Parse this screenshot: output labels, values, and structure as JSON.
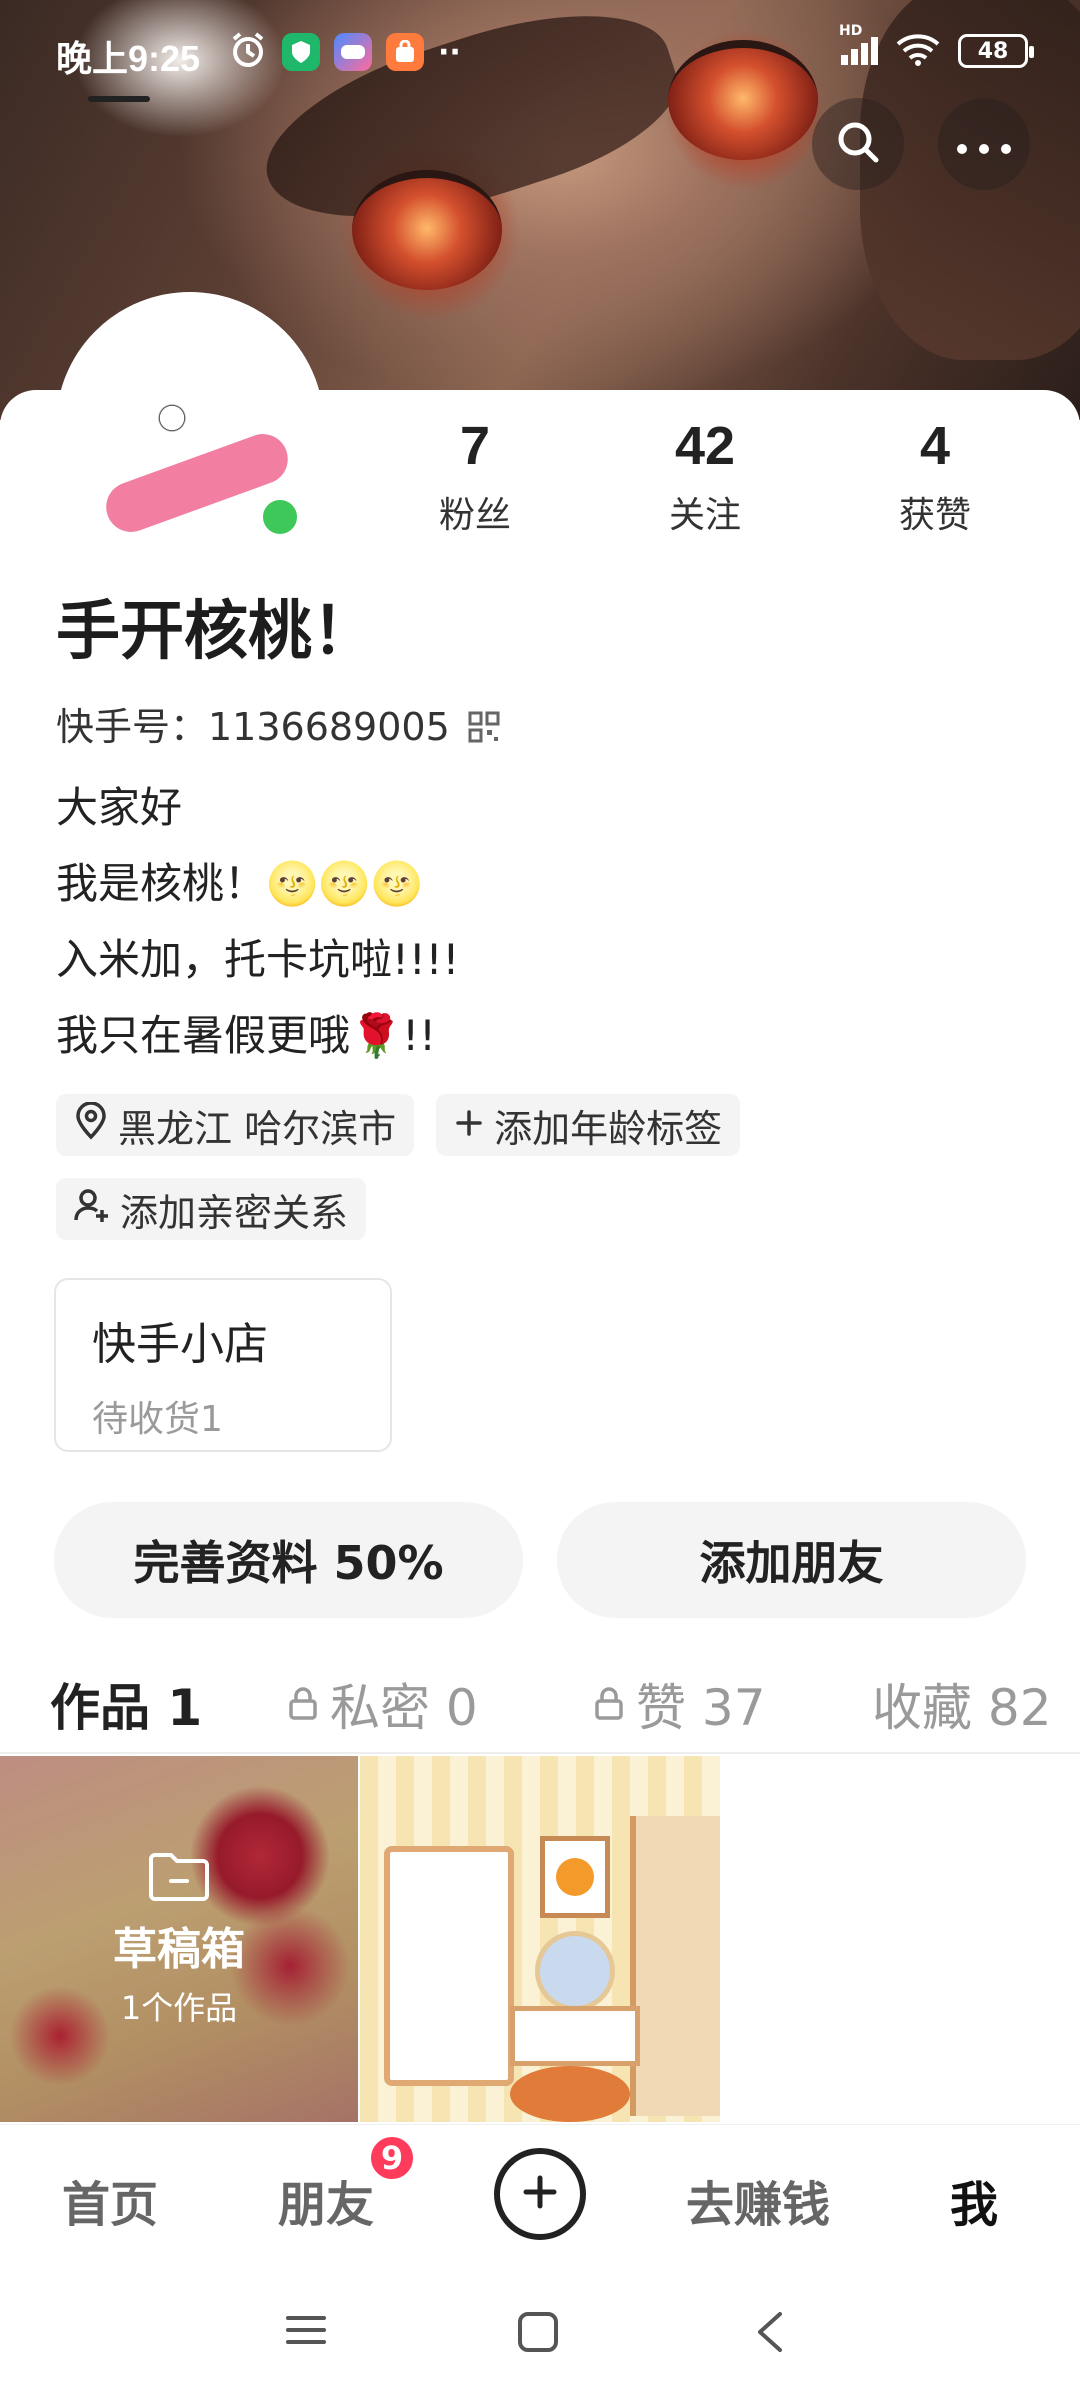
{
  "status_bar": {
    "time": "晚上9:25",
    "network_label": "HD",
    "battery": "48",
    "icons": [
      "alarm-icon",
      "shield-app-icon",
      "game-app-icon",
      "shop-app-icon",
      "more-dots-icon",
      "signal-icon",
      "wifi-icon",
      "battery-icon"
    ]
  },
  "header": {
    "search_icon": "search-icon",
    "more_icon": "more-icon"
  },
  "profile": {
    "stats": [
      {
        "value": "7",
        "label": "粉丝"
      },
      {
        "value": "42",
        "label": "关注"
      },
      {
        "value": "4",
        "label": "获赞"
      }
    ],
    "nickname": "手开核桃！",
    "uid_text": "快手号：1136689005",
    "bio_lines": [
      "大家好",
      "我是核桃！🌝🌝🌝",
      "入米加，托卡坑啦!!!!",
      "我只在暑假更哦🌹!!"
    ],
    "tags": {
      "location": "黑龙江 哈尔滨市",
      "age": "添加年龄标签",
      "relation": "添加亲密关系"
    },
    "online_color": "#3ec85a"
  },
  "shop": {
    "title": "快手小店",
    "subtitle": "待收货1"
  },
  "actions": {
    "complete_profile": "完善资料 50%",
    "add_friend": "添加朋友"
  },
  "tabs": {
    "works": "作品 1",
    "private": "私密 0",
    "likes": "赞 37",
    "favorites": "收藏 82"
  },
  "grid": {
    "draft_title": "草稿箱",
    "draft_count": "1个作品"
  },
  "bottom_nav": {
    "home": "首页",
    "friends": "朋友",
    "friends_badge": "9",
    "earn": "去赚钱",
    "me": "我"
  },
  "colors": {
    "badge": "#ff3b5c",
    "text_primary": "#222222",
    "text_muted": "#9a9a9a"
  }
}
